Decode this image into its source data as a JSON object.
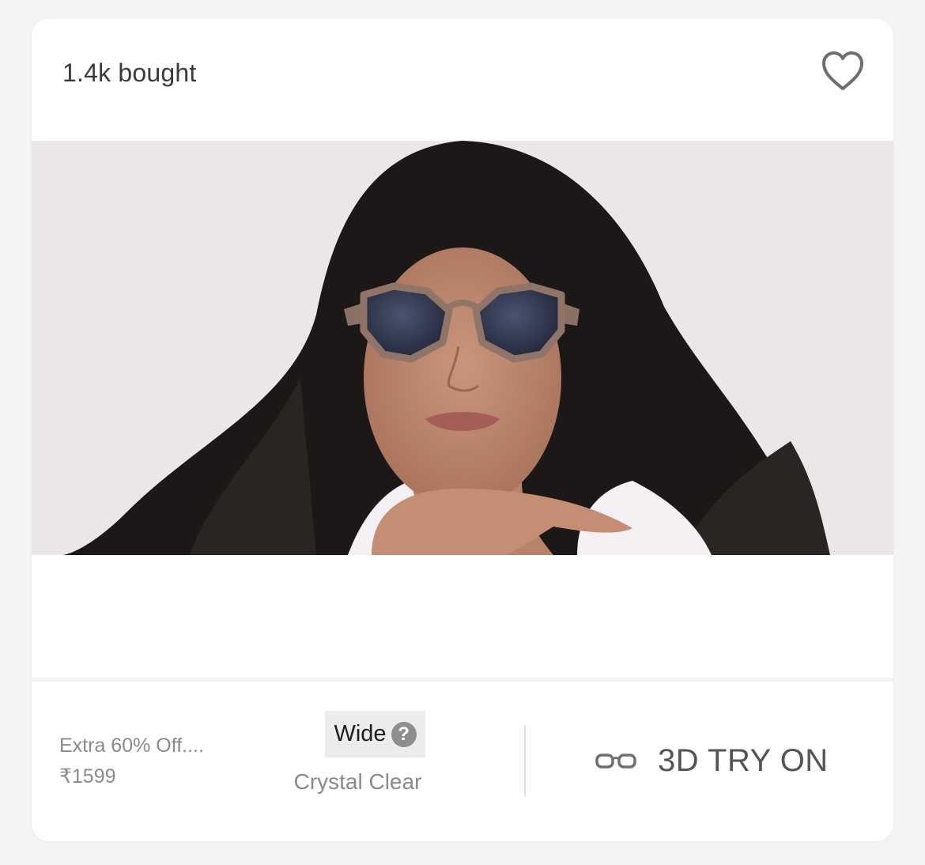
{
  "card": {
    "bought_label": "1.4k bought",
    "wishlist_icon": "heart-outline-icon",
    "image": {
      "subject": "model wearing tinted octagonal sunglasses",
      "background_color": "#ebe6e7"
    }
  },
  "footer": {
    "offer_text": "Extra 60% Off....",
    "price": "₹1599",
    "frame_size": "Wide",
    "help_icon": "?",
    "frame_color": "Crystal Clear",
    "try_on_label": "3D TRY ON",
    "try_on_icon": "glasses-icon"
  },
  "colors": {
    "text_primary": "#3a3a3a",
    "text_muted": "#8a8a8a",
    "badge_bg": "#ececec",
    "card_bg": "#ffffff",
    "page_bg": "#f4f4f4"
  }
}
